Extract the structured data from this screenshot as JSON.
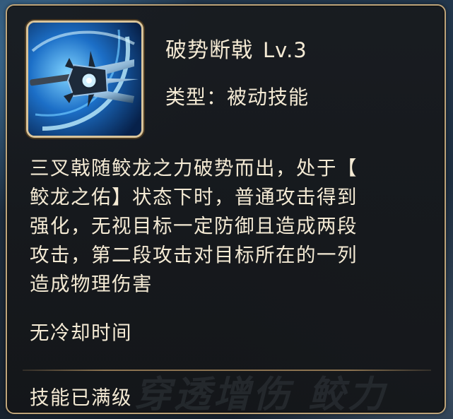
{
  "skill": {
    "name": "破势断戟",
    "level": "Lv.3",
    "type_label": "类型：被动技能",
    "icon": "trident-halberd-icon",
    "description_lines": [
      "三叉戟随鲛龙之力破势而出，处于【",
      "鲛龙之佑】状态下时，普通攻击得到",
      "强化，无视目标一定防御且造成两段",
      "攻击，第二段攻击对目标所在的一列",
      "造成物理伤害"
    ],
    "cooldown": "无冷却时间",
    "max_level_note": "技能已满级"
  },
  "background_watermark": "穿透增伤 鲛力",
  "colors": {
    "text": "#f4ead4",
    "panel_border": "#bfa57a",
    "panel_bg": "#16181c",
    "divider": "#8b7350"
  }
}
